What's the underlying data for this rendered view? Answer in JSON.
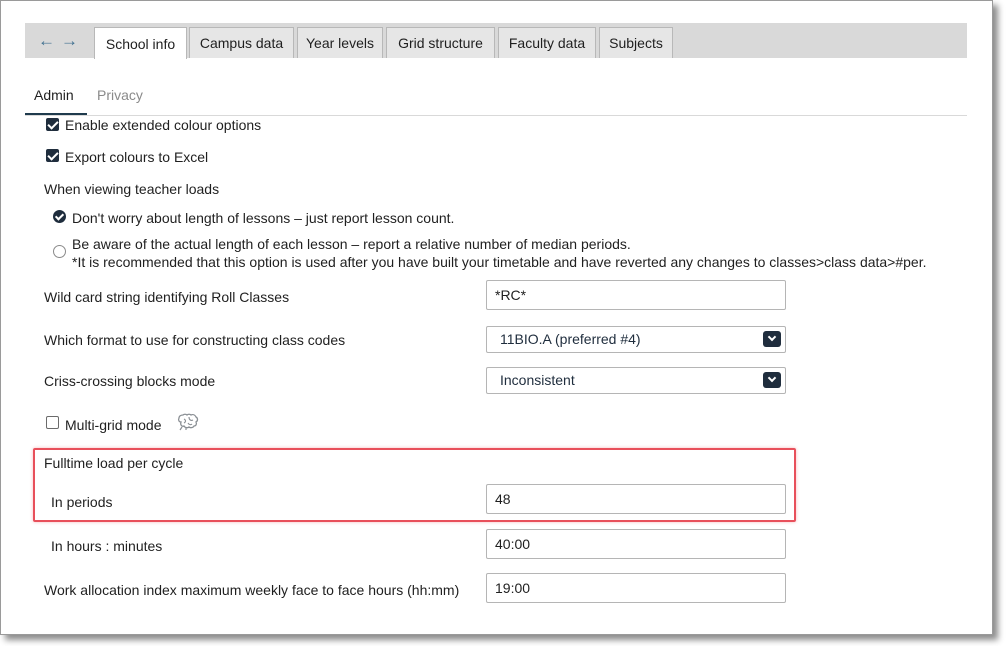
{
  "tabs": [
    {
      "label": "School info",
      "active": true
    },
    {
      "label": "Campus data"
    },
    {
      "label": "Year levels"
    },
    {
      "label": "Grid structure"
    },
    {
      "label": "Faculty data"
    },
    {
      "label": "Subjects"
    }
  ],
  "nav": {
    "back_icon": "arrow-left-icon",
    "forward_icon": "arrow-right-icon"
  },
  "subtabs": [
    {
      "label": "Admin",
      "active": true
    },
    {
      "label": "Privacy"
    }
  ],
  "options": {
    "extended_colour": {
      "label": "Enable extended colour options",
      "checked": true
    },
    "export_colours": {
      "label": "Export colours to Excel",
      "checked": true
    },
    "teacher_loads_heading": "When viewing teacher loads",
    "radio_count": {
      "label": "Don't worry about length of lessons – just report lesson count.",
      "checked": true
    },
    "radio_length": {
      "label": "Be aware of the actual length of each lesson – report a relative number of median periods.",
      "note": "*It is recommended that this option is used after you have built your timetable and have reverted any changes to classes>class data>#per.",
      "checked": false
    },
    "multi_grid": {
      "label": "Multi-grid mode",
      "checked": false,
      "icon": "brain-icon"
    }
  },
  "fields": {
    "wildcard": {
      "label": "Wild card string identifying Roll Classes",
      "value": "*RC*"
    },
    "class_code_format": {
      "label": "Which format to use for constructing class codes",
      "value": "11BIO.A (preferred #4)"
    },
    "criss_crossing": {
      "label": "Criss-crossing blocks mode",
      "value": "Inconsistent"
    },
    "fulltime_heading": "Fulltime load per cycle",
    "in_periods": {
      "label": "In periods",
      "value": "48"
    },
    "in_hours": {
      "label": "In hours : minutes",
      "value": "40:00"
    },
    "work_allocation": {
      "label": "Work allocation index maximum weekly face to face hours (hh:mm)",
      "value": "19:00"
    }
  },
  "colors": {
    "accent": "#1f2d3d",
    "highlight": "#e8505b",
    "tabbar": "#d9d9d9"
  }
}
